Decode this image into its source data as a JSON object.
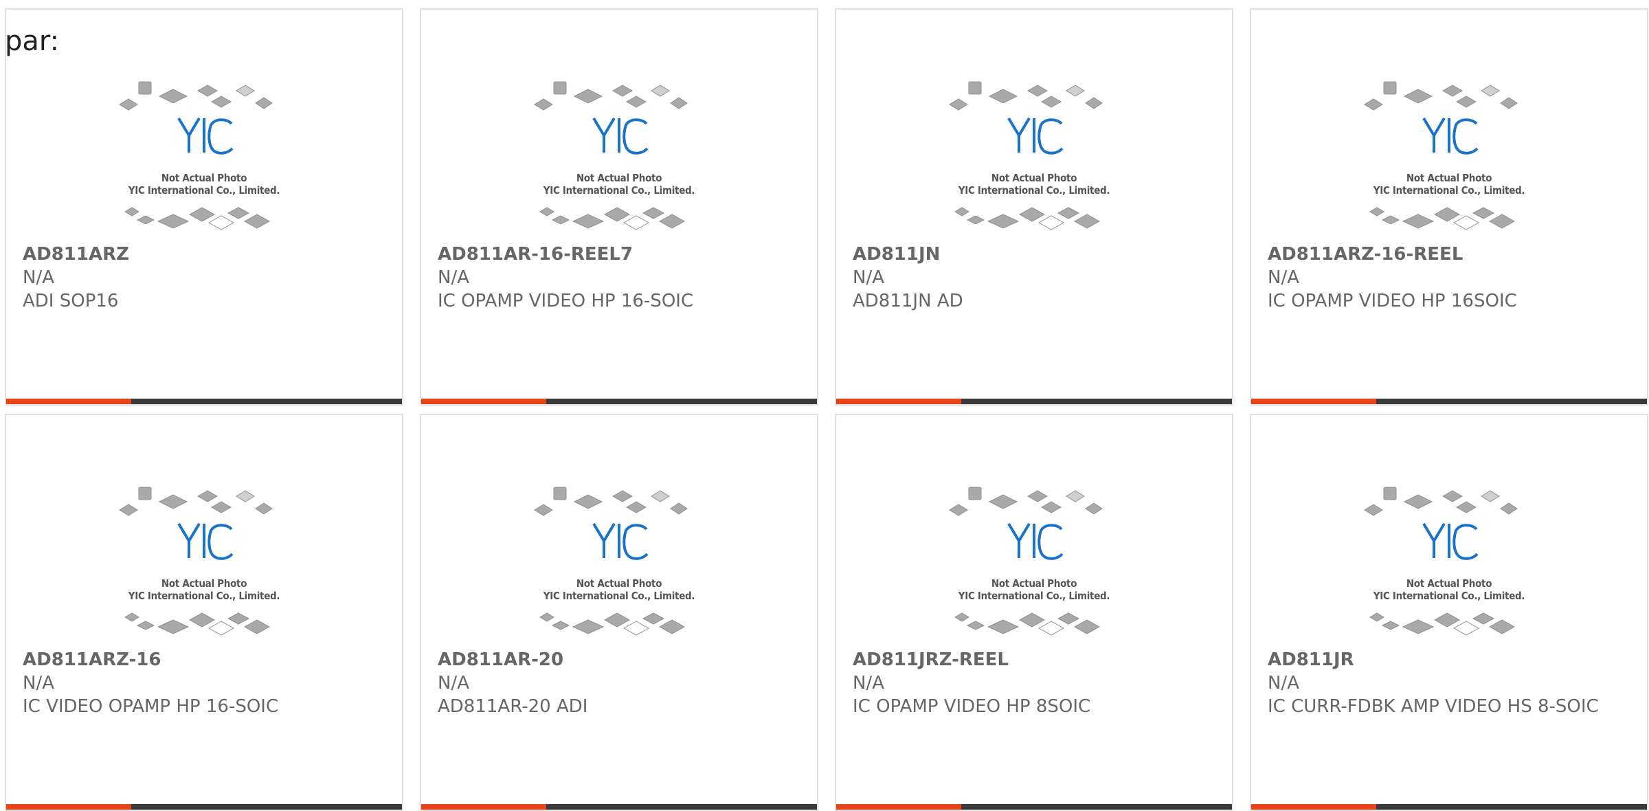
{
  "prefix_label": "par:",
  "photo_caption": {
    "line1": "Not Actual Photo",
    "line2": "YIC International Co., Limited.",
    "logo_text": "YIC"
  },
  "colors": {
    "accent": "#e8441a",
    "bar": "#3a3a3a",
    "logo_blue": "#1a73c9",
    "text": "#666666"
  },
  "products": [
    {
      "part": "AD811ARZ",
      "price": "N/A",
      "desc": "ADI SOP16"
    },
    {
      "part": "AD811AR-16-REEL7",
      "price": "N/A",
      "desc": "IC OPAMP VIDEO HP 16-SOIC"
    },
    {
      "part": "AD811JN",
      "price": "N/A",
      "desc": "AD811JN AD"
    },
    {
      "part": "AD811ARZ-16-REEL",
      "price": "N/A",
      "desc": "IC OPAMP VIDEO HP 16SOIC"
    },
    {
      "part": "AD811ARZ-16",
      "price": "N/A",
      "desc": "IC VIDEO OPAMP HP 16-SOIC"
    },
    {
      "part": "AD811AR-20",
      "price": "N/A",
      "desc": "AD811AR-20 ADI"
    },
    {
      "part": "AD811JRZ-REEL",
      "price": "N/A",
      "desc": "IC OPAMP VIDEO HP 8SOIC"
    },
    {
      "part": "AD811JR",
      "price": "N/A",
      "desc": "IC CURR-FDBK AMP VIDEO HS 8-SOIC"
    }
  ]
}
